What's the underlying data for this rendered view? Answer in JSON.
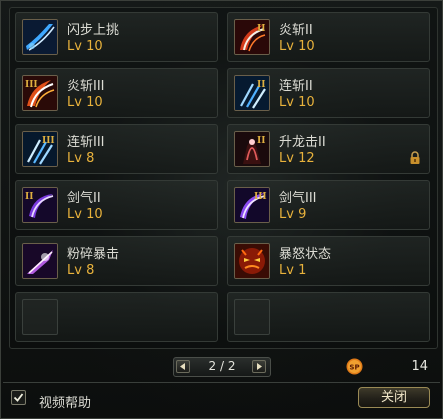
{
  "skills": [
    {
      "name": "闪步上挑",
      "level": "Lv 10",
      "icon": "slash-blue-icon",
      "tier": ""
    },
    {
      "name": "炎斩II",
      "level": "Lv 10",
      "icon": "fire-slash-icon",
      "tier": "II"
    },
    {
      "name": "炎斩III",
      "level": "Lv 10",
      "icon": "fire-slash-icon",
      "tier": "III"
    },
    {
      "name": "连斩II",
      "level": "Lv 10",
      "icon": "triple-slash-icon",
      "tier": "II"
    },
    {
      "name": "连斩III",
      "level": "Lv 8",
      "icon": "triple-slash-icon",
      "tier": "III"
    },
    {
      "name": "升龙击II",
      "level": "Lv 12",
      "icon": "rising-dragon-icon",
      "tier": "II",
      "locked": true
    },
    {
      "name": "剑气II",
      "level": "Lv 10",
      "icon": "sword-wave-icon",
      "tier": "II"
    },
    {
      "name": "剑气III",
      "level": "Lv 9",
      "icon": "sword-wave-icon",
      "tier": "III"
    },
    {
      "name": "粉碎暴击",
      "level": "Lv 8",
      "icon": "shatter-strike-icon",
      "tier": ""
    },
    {
      "name": "暴怒状态",
      "level": "Lv 1",
      "icon": "rage-state-icon",
      "tier": ""
    }
  ],
  "pager": {
    "text": "2 / 2"
  },
  "sp": {
    "label": "SP",
    "value": "14"
  },
  "footer": {
    "help_label": "视频帮助",
    "help_checked": true,
    "close_label": "关闭"
  },
  "colors": {
    "level": "#e8b23c",
    "text": "#dcdcd4",
    "tier": "#e0b040"
  }
}
